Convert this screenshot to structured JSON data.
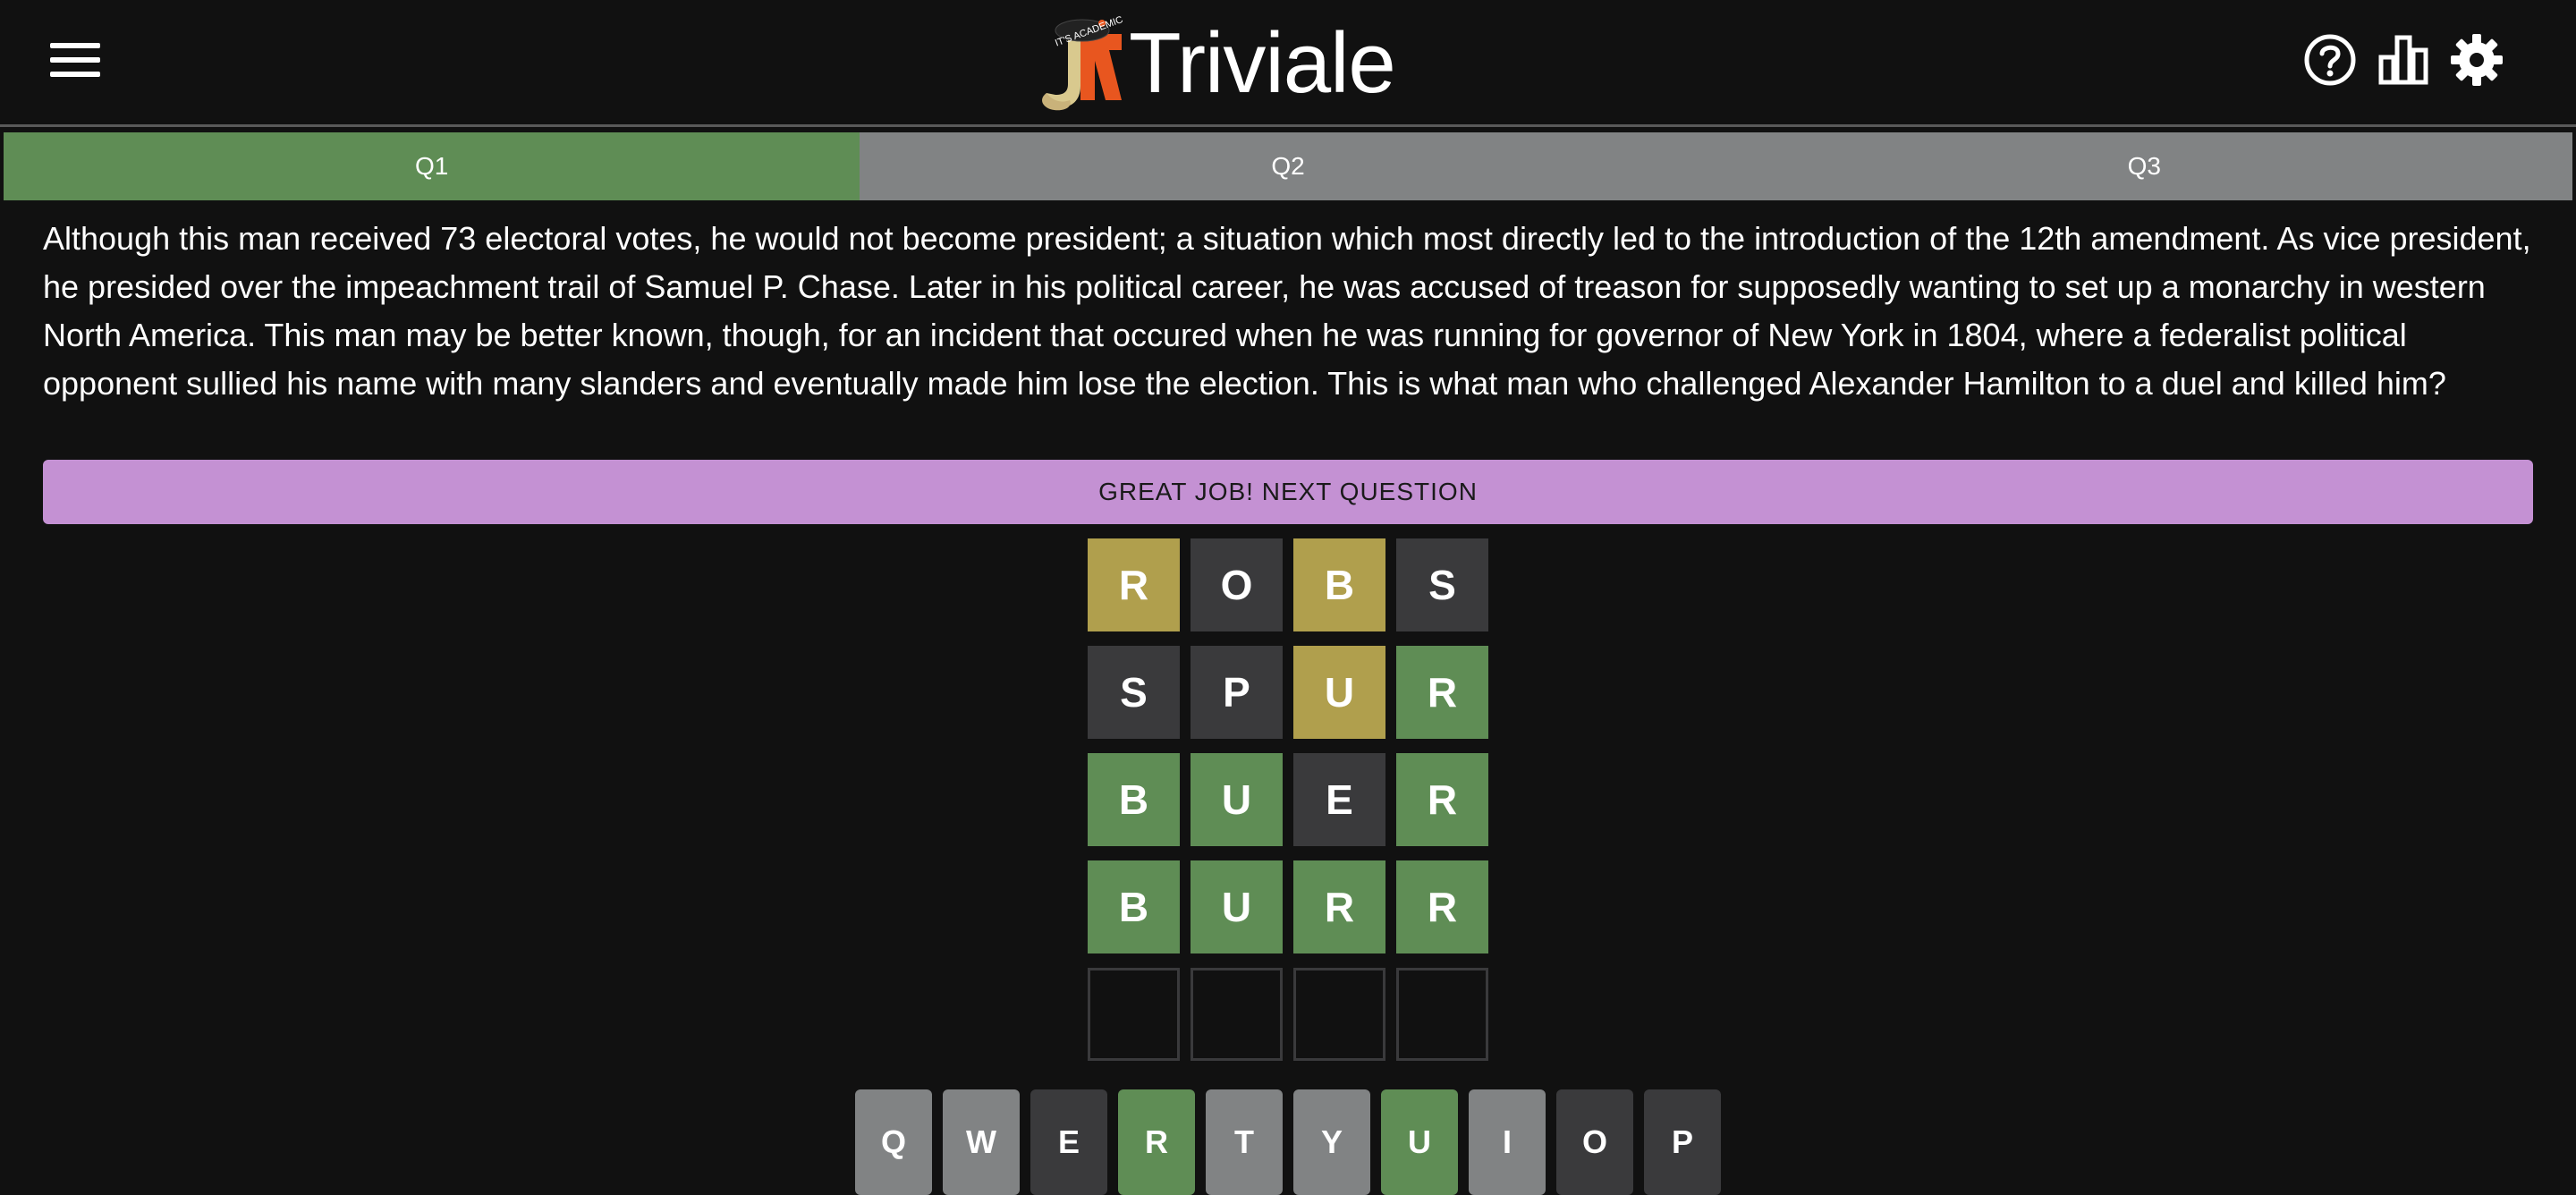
{
  "app": {
    "title": "Triviale",
    "logo_text": "IT'S ACADEMIC"
  },
  "header": {
    "icons": [
      "menu-icon",
      "help-icon",
      "stats-icon",
      "settings-icon"
    ]
  },
  "tabs": [
    {
      "label": "Q1",
      "active": true
    },
    {
      "label": "Q2",
      "active": false
    },
    {
      "label": "Q3",
      "active": false
    }
  ],
  "question": {
    "text": "Although this man received 73 electoral votes, he would not become president; a situation which most directly led to the introduction of the 12th amendment. As vice president, he presided over the impeachment trail of Samuel P. Chase. Later in his political career, he was accused of treason for supposedly wanting to set up a monarchy in western North America. This man may be better known, though, for an incident that occured when he was running for governor of New York in 1804, where a federalist political opponent sullied his name with many slanders and eventually made him lose the election. This is what man who challenged Alexander Hamilton to a duel and killed him?"
  },
  "next_button": {
    "label": "GREAT JOB! NEXT QUESTION"
  },
  "board": {
    "rows": [
      [
        {
          "letter": "R",
          "state": "present"
        },
        {
          "letter": "O",
          "state": "absent"
        },
        {
          "letter": "B",
          "state": "present"
        },
        {
          "letter": "S",
          "state": "absent"
        }
      ],
      [
        {
          "letter": "S",
          "state": "absent"
        },
        {
          "letter": "P",
          "state": "absent"
        },
        {
          "letter": "U",
          "state": "present"
        },
        {
          "letter": "R",
          "state": "correct"
        }
      ],
      [
        {
          "letter": "B",
          "state": "correct"
        },
        {
          "letter": "U",
          "state": "correct"
        },
        {
          "letter": "E",
          "state": "absent"
        },
        {
          "letter": "R",
          "state": "correct"
        }
      ],
      [
        {
          "letter": "B",
          "state": "correct"
        },
        {
          "letter": "U",
          "state": "correct"
        },
        {
          "letter": "R",
          "state": "correct"
        },
        {
          "letter": "R",
          "state": "correct"
        }
      ],
      [
        {
          "letter": "",
          "state": "empty"
        },
        {
          "letter": "",
          "state": "empty"
        },
        {
          "letter": "",
          "state": "empty"
        },
        {
          "letter": "",
          "state": "empty"
        }
      ]
    ]
  },
  "keyboard": {
    "rows": [
      [
        {
          "key": "Q",
          "state": "unused"
        },
        {
          "key": "W",
          "state": "unused"
        },
        {
          "key": "E",
          "state": "absent"
        },
        {
          "key": "R",
          "state": "correct"
        },
        {
          "key": "T",
          "state": "unused"
        },
        {
          "key": "Y",
          "state": "unused"
        },
        {
          "key": "U",
          "state": "correct"
        },
        {
          "key": "I",
          "state": "unused"
        },
        {
          "key": "O",
          "state": "absent"
        },
        {
          "key": "P",
          "state": "absent"
        }
      ]
    ]
  },
  "colors": {
    "background": "#111111",
    "correct": "#5f8d55",
    "present": "#b09f4d",
    "absent": "#3a3a3c",
    "unused": "#818384",
    "next_button": "#c491d3"
  }
}
